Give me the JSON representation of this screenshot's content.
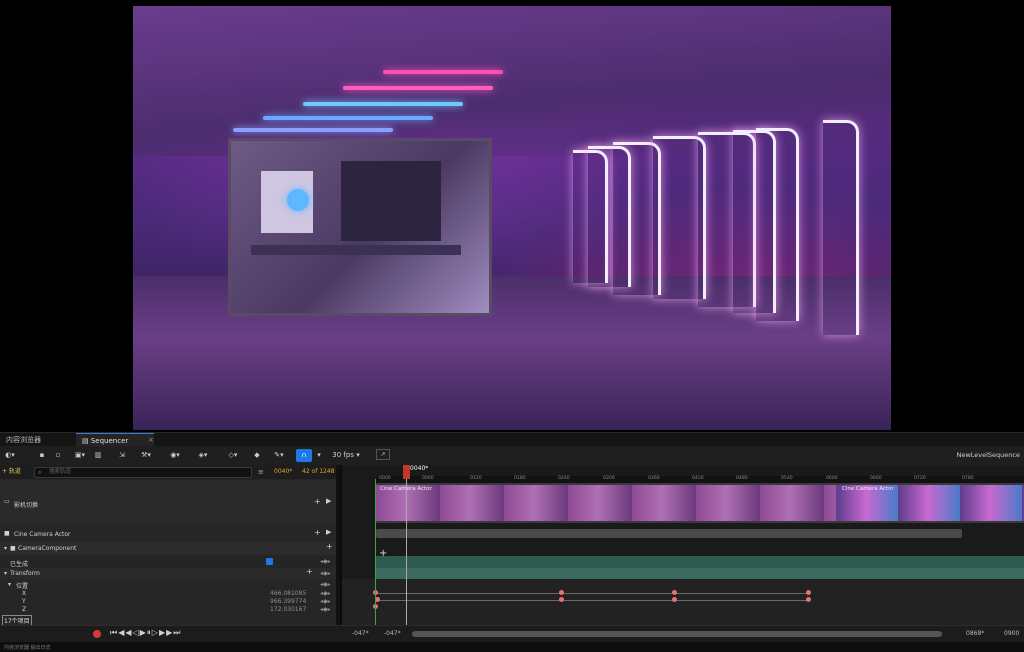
{
  "tabs": {
    "content_browser": "内容浏览器",
    "sequencer": "Sequencer"
  },
  "toolbar": {
    "fps": "30 fps",
    "sequence_name": "NewLevelSequence"
  },
  "filter": {
    "add_track": "+ 轨道",
    "search_placeholder": "搜索轨道",
    "current_frame": "0040*",
    "count": "42 of 1248"
  },
  "tracks": {
    "shot": "影机切换",
    "camera_actor": "Cine Camera Actor",
    "camera_component": "CameraComponent",
    "spawned": "已生成",
    "transform": "Transform",
    "location": "位置",
    "x_label": "X",
    "x_value": "466.081085",
    "y_label": "Y",
    "y_value": "966.399774",
    "z_label": "Z",
    "z_value": "172.030167",
    "items_count": "17个项目"
  },
  "clip": {
    "label": "Cine Camera Actor",
    "label2": "Cine Camera Actor"
  },
  "ruler": {
    "playhead": "0040*",
    "ticks": [
      "0000",
      "0060",
      "0120",
      "0180",
      "0240",
      "0300",
      "0360",
      "0420",
      "0480",
      "0540",
      "0600",
      "0660",
      "0720",
      "0780"
    ]
  },
  "transport_bar": {
    "range_start": "-047*",
    "range_start2": "-047*",
    "range_end": "0868*",
    "range_end2": "0900"
  },
  "status": {
    "left": "内容浏览器 输出日志",
    "right": ""
  },
  "colors": {
    "accent": "#3a7bd5",
    "playhead": "#c0392b",
    "key": "#e57373",
    "track_green": "#4a7f6a"
  }
}
